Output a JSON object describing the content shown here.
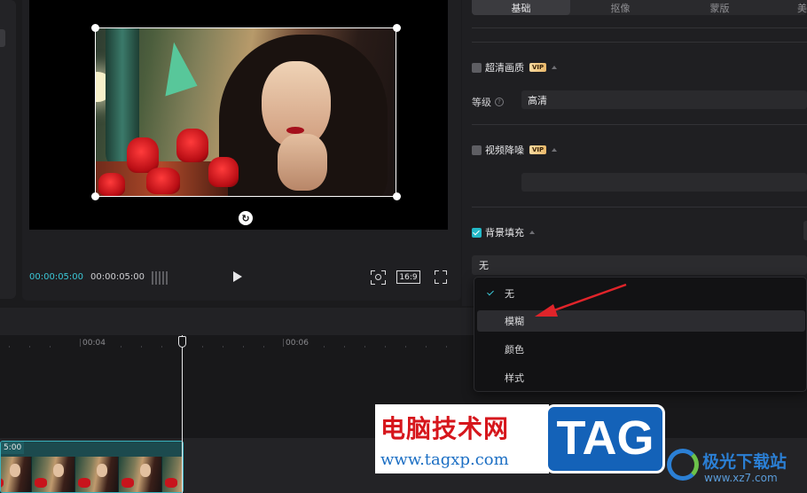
{
  "player": {
    "time_current": "00:00:05:00",
    "time_total": "00:00:05:00",
    "ratio_label": "16:9"
  },
  "panel": {
    "tabs": [
      "基础",
      "抠像",
      "蒙版",
      "美"
    ],
    "active_tab": "基础",
    "super_quality": {
      "label": "超清画质",
      "badge": "VIP",
      "checked": false
    },
    "level": {
      "label": "等级",
      "value": "高清"
    },
    "noise": {
      "label": "视频降噪",
      "badge": "VIP",
      "checked": false
    },
    "bg_fill": {
      "label": "背景填充",
      "checked": true,
      "value": "无"
    }
  },
  "dropdown": {
    "options": [
      "无",
      "模糊",
      "颜色",
      "样式"
    ],
    "selected": "无",
    "hovered": "模糊"
  },
  "timeline": {
    "ruler": [
      "00:04",
      "00:06"
    ],
    "clip_time": "5:00"
  },
  "watermark": {
    "title": "电脑技术网",
    "url": "www.tagxp.com",
    "tag": "TAG",
    "site2_title": "极光下载站",
    "site2_url": "www.xz7.com"
  },
  "colors": {
    "accent": "#3bc7d6",
    "arrow": "#e0242a",
    "background": "#1b1b1d"
  }
}
